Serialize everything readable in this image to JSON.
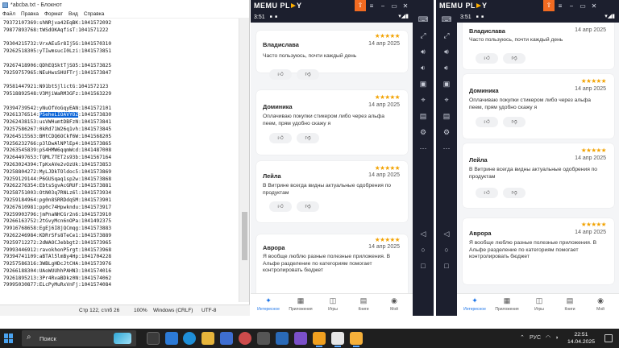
{
  "notepad": {
    "title": "*abcba.txt - Блокнот",
    "menu": [
      "Файл",
      "Правка",
      "Формат",
      "Вид",
      "Справка"
    ],
    "lines": [
      {
        "pre": "79372107369:shNRjva42EqBK:1041572092",
        "hl": "",
        "post": ""
      },
      {
        "pre": "79877893768:tWSdOKAqfisT:1041571222",
        "hl": "",
        "post": ""
      },
      {
        "pre": "",
        "hl": "",
        "post": ""
      },
      {
        "pre": "79304215732:VrxAEu5r8Ij5G:1041570310",
        "hl": "",
        "post": ""
      },
      {
        "pre": "79262518305:yTIwmsucI0Lzi:1041573851",
        "hl": "",
        "post": ""
      },
      {
        "pre": "",
        "hl": "",
        "post": ""
      },
      {
        "pre": "79267418906:QDhEQSktTjSO5:1041573825",
        "hl": "",
        "post": ""
      },
      {
        "pre": "79259757965:NEuHwsSHUFTrj:1041573847",
        "hl": "",
        "post": ""
      },
      {
        "pre": "",
        "hl": "",
        "post": ""
      },
      {
        "pre": "79581447921:N91btSjlictG:1041572123",
        "hl": "",
        "post": ""
      },
      {
        "pre": "79518892548:V3MjiWaRM3GFz:1041563229",
        "hl": "",
        "post": ""
      },
      {
        "pre": "",
        "hl": "",
        "post": ""
      },
      {
        "pre": "79394739542:yNuOfVoGqyEAN:1041572101",
        "hl": "",
        "post": ""
      },
      {
        "pre": "79261376514:",
        "hl": "PSeheLIOAVYOZ",
        "post": ":1041573830"
      },
      {
        "pre": "79262438153:usVWHumtDBFzN:1041573841",
        "hl": "",
        "post": ""
      },
      {
        "pre": "79257586267:0kRd71W26q1vh:1041573845",
        "hl": "",
        "post": ""
      },
      {
        "pre": "79264515563:BMtCDQ6OCkf6W:1041568205",
        "hl": "",
        "post": ""
      },
      {
        "pre": "79256232766:p3lDwAlNPlEp4:1041573865",
        "hl": "",
        "post": ""
      },
      {
        "pre": "79263545839:pS4HMW6qqmWcd:1041487008",
        "hl": "",
        "post": ""
      },
      {
        "pre": "79264497653:TQML7TET2s93b:1041567164",
        "hl": "",
        "post": ""
      },
      {
        "pre": "79263024394:TpKxAVe2vOzUk:1041573853",
        "hl": "",
        "post": ""
      },
      {
        "pre": "79258804272:MyLJDkTOldoc5:1041573869",
        "hl": "",
        "post": ""
      },
      {
        "pre": "79259129144:P6GUSqaq1sp2w:1041573868",
        "hl": "",
        "post": ""
      },
      {
        "pre": "79262276354:EbtsSgvAcGRUF:1041573881",
        "hl": "",
        "post": ""
      },
      {
        "pre": "79258751003:OtN03q7RNLz6l:1041573934",
        "hl": "",
        "post": ""
      },
      {
        "pre": "79259184964:pg0n8SRRDdqSM:1041573901",
        "hl": "",
        "post": ""
      },
      {
        "pre": "79267610981:pp0c74Hpwkndu:1041573917",
        "hl": "",
        "post": ""
      },
      {
        "pre": "79259903796:jmPnaNHCGr2n6:1041573910",
        "hl": "",
        "post": ""
      },
      {
        "pre": "79266163752:2tGvyMcn6nOPa:1041492375",
        "hl": "",
        "post": ""
      },
      {
        "pre": "79916768658:EgEj6I8jQCmqg:1041573883",
        "hl": "",
        "post": ""
      },
      {
        "pre": "79262246984:KDRrSFs8TeCe1:1041573889",
        "hl": "",
        "post": ""
      },
      {
        "pre": "79259712272:2dWAOCJebbgt2:1041573965",
        "hl": "",
        "post": ""
      },
      {
        "pre": "79993446912:ravokhonP5rgt:1041573968",
        "hl": "",
        "post": ""
      },
      {
        "pre": "79394741109:aBTAl5lmBy4Hp:1041704228",
        "hl": "",
        "post": ""
      },
      {
        "pre": "79257586316:3WBLgHDcJtCHA:1041573976",
        "hl": "",
        "post": ""
      },
      {
        "pre": "79266188304:UAoWUUhhPAHN3:1041574016",
        "hl": "",
        "post": ""
      },
      {
        "pre": "79261895213:3Pr4RvaBDkz0N:1041574062",
        "hl": "",
        "post": ""
      },
      {
        "pre": "79995030877:ELcPyMuRxVnFj:1041574084",
        "hl": "",
        "post": ""
      }
    ],
    "status": {
      "position": "Стр 122, стлб 26",
      "zoom": "100%",
      "line_ending": "Windows (CRLF)",
      "encoding": "UTF-8"
    }
  },
  "emulator_left": {
    "brand": {
      "a": "MEMU PL",
      "b": "Y"
    },
    "time": "3:51",
    "reviews": [
      {
        "name": "Владислава",
        "stars": "★★★★★",
        "date": "14 апр 2025",
        "text": [
          "Часто пользуюсь, почти каждый день"
        ]
      },
      {
        "name": "Доминика",
        "stars": "★★★★★",
        "date": "14 апр 2025",
        "text": [
          "Оплачиваю покупки стикером либо через альфа",
          "пеем, прям удобно скажу я"
        ]
      },
      {
        "name": "Лейла",
        "stars": "★★★★★",
        "date": "14 апр 2025",
        "text": [
          "В Витрине всегда видны актуальные одобрения по",
          "продуктам"
        ]
      },
      {
        "name": "Аврора",
        "stars": "★★★★★",
        "date": "14 апр 2025",
        "text": [
          "Я вообще люблю разные полезные приложения. В",
          "Альфе разделение по категориям помогает",
          "контролировать бюджет"
        ]
      }
    ],
    "nav": [
      "Интересное",
      "Приложения",
      "Игры",
      "Книги",
      "Мой"
    ]
  },
  "emulator_right": {
    "brand": {
      "a": "MEMU PL",
      "b": "Y"
    },
    "time": "3:51",
    "reviews": [
      {
        "name": "Владислава",
        "stars": "",
        "date": "14 апр 2025",
        "text": [
          "Часто пользуюсь, почти каждый день"
        ]
      },
      {
        "name": "Доминика",
        "stars": "★★★★★",
        "date": "14 апр 2025",
        "text": [
          "Оплачиваю покупки стикером либо через альфа",
          "пеем, прям удобно скажу я"
        ]
      },
      {
        "name": "Лейла",
        "stars": "★★★★★",
        "date": "14 апр 2025",
        "text": [
          "В Витрине всегда видны актуальные одобрения по",
          "продуктам"
        ]
      },
      {
        "name": "Аврора",
        "stars": "★★★★★",
        "date": "14 апр 2025",
        "text": [
          "Я вообще люблю разные полезные приложения. В",
          "Альфе разделение по категориям помогает",
          "контролировать бюджет"
        ]
      }
    ],
    "nav": [
      "Интересное",
      "Приложения",
      "Игры",
      "Книги",
      "Мой"
    ]
  },
  "taskbar": {
    "search_placeholder": "Поиск",
    "lang": "РУС",
    "time": "22:51",
    "date": "14.04.2025"
  },
  "icons": {
    "thumb_up": "thumb-up-icon",
    "thumb_down": "thumb-down-icon"
  }
}
